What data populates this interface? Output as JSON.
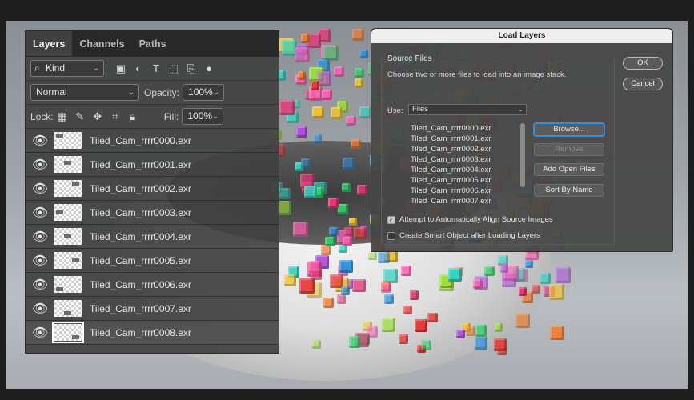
{
  "layers_panel": {
    "tabs": [
      {
        "label": "Layers"
      },
      {
        "label": "Channels"
      },
      {
        "label": "Paths"
      }
    ],
    "filter_kind": "Kind",
    "blend_mode": "Normal",
    "opacity_label": "Opacity:",
    "opacity_value": "100%",
    "lock_label": "Lock:",
    "fill_label": "Fill:",
    "fill_value": "100%",
    "layers": [
      {
        "name": "Tiled_Cam_rrrr0000.exr"
      },
      {
        "name": "Tiled_Cam_rrrr0001.exr"
      },
      {
        "name": "Tiled_Cam_rrrr0002.exr"
      },
      {
        "name": "Tiled_Cam_rrrr0003.exr"
      },
      {
        "name": "Tiled_Cam_rrrr0004.exr"
      },
      {
        "name": "Tiled_Cam_rrrr0005.exr"
      },
      {
        "name": "Tiled_Cam_rrrr0006.exr"
      },
      {
        "name": "Tiled_Cam_rrrr0007.exr"
      },
      {
        "name": "Tiled_Cam_rrrr0008.exr"
      }
    ]
  },
  "dialog": {
    "title": "Load Layers",
    "group_title": "Source Files",
    "hint": "Choose two or more files to load into an image stack.",
    "use_label": "Use:",
    "use_value": "Files",
    "files": [
      "Tiled_Cam_rrrr0000.exr",
      "Tiled_Cam_rrrr0001.exr",
      "Tiled_Cam_rrrr0002.exr",
      "Tiled_Cam_rrrr0003.exr",
      "Tiled_Cam_rrrr0004.exr",
      "Tiled_Cam_rrrr0005.exr",
      "Tiled_Cam_rrrr0006.exr",
      "Tiled_Cam_rrrr0007.exr"
    ],
    "browse": "Browse...",
    "remove": "Remove",
    "add_open": "Add Open Files",
    "sort": "Sort By Name",
    "ok": "OK",
    "cancel": "Cancel",
    "align_label": "Attempt to Automatically Align Source Images",
    "align_checked": true,
    "smart_label": "Create Smart Object after Loading Layers",
    "smart_checked": false
  },
  "colors": {
    "panel_bg": "#404040",
    "accent_focus": "#3b8bdb",
    "cube_palette": [
      "#e8357a",
      "#2fd36b",
      "#f2c230",
      "#2b8fe0",
      "#e83a3a",
      "#35d4c4",
      "#b04de0",
      "#f07a2a",
      "#9be03a",
      "#ff5fb5"
    ]
  }
}
